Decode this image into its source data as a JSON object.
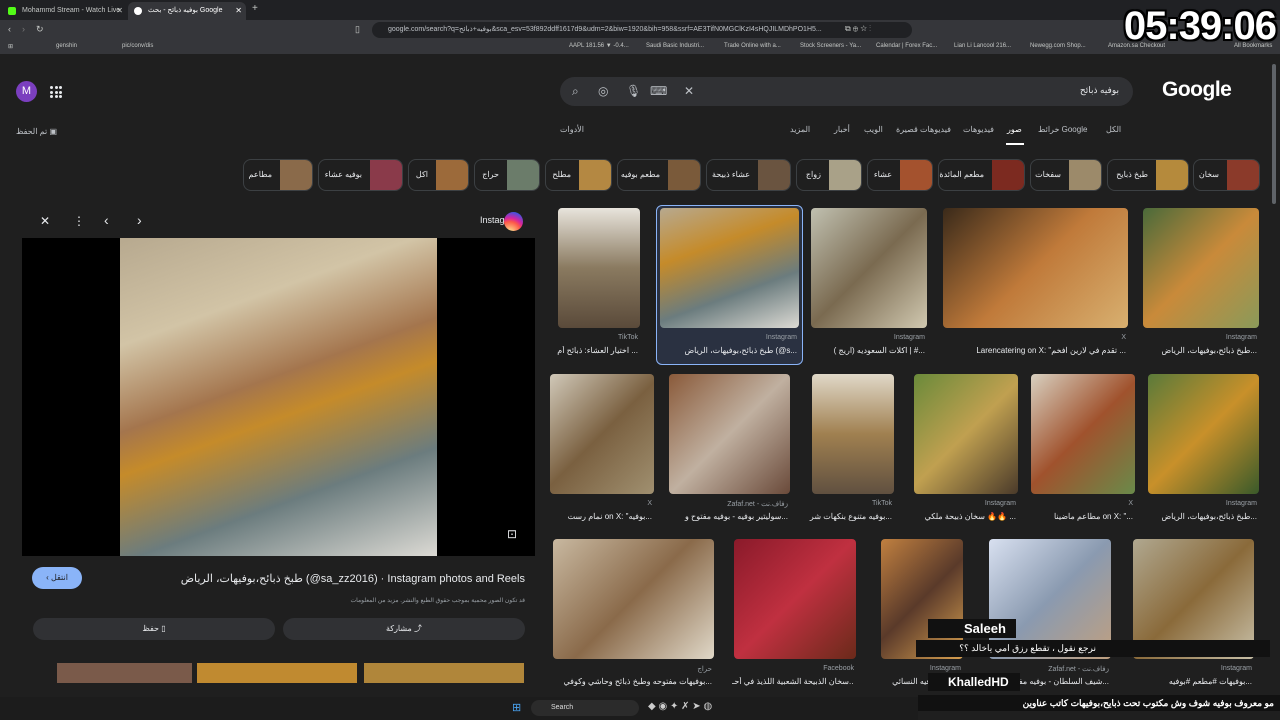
{
  "browser": {
    "tabs": [
      {
        "title": "Mohammd Stream - Watch Live",
        "active": false
      },
      {
        "title": "بوفيه ذبائح - بحث Google",
        "active": true
      }
    ],
    "url": "google.com/search?q=بوفيه+ذبائح&sca_esv=53f892ddff1617d9&udm=2&biw=1920&bih=958&ssrf=AE3TifN0MGClKzI4sHQJILMDhPO1H5...",
    "bookmarks": [
      "genshin",
      "pic/conv/dis",
      "AAPL 181.56 ▼ -0.4...",
      "Saudi Basic Industri...",
      "Trade Online with a...",
      "Stock Screeners - Ya...",
      "Calendar | Forex Fac...",
      "Lian Li Lancool 216...",
      "Newegg.com Shop...",
      "Amazon.sa Checkout",
      "All Bookmarks"
    ]
  },
  "clock": "05:39:06",
  "google": {
    "logo": "Google",
    "avatar_letter": "M",
    "query": "بوفيه ذبائح",
    "nav": [
      "الكل",
      "خرائط Google",
      "صور",
      "فيديوهات",
      "فيديوهات قصيرة",
      "الويب",
      "أخبار",
      "المزيد"
    ],
    "tools": "الأدوات",
    "saved": "تم الحفظ"
  },
  "chips": [
    "سخان",
    "طبخ ذبايح",
    "سفخات",
    "مطعم المائدة",
    "عشاء",
    "زواج",
    "عشاء ذبيحة",
    "مطعم بوفيه",
    "مطلح",
    "حراج",
    "اكل",
    "بوفيه عشاء",
    "مطاعم"
  ],
  "preview": {
    "source": "Instagram",
    "caption": "طبخ ذبائح،بوفيهات، الرياض (@sa_zz2016) · Instagram photos and Reels",
    "notice": "قد تكون الصور محمية بموجب حقوق الطبع والنشر. مزيد من المعلومات",
    "visit": "انتقل",
    "share": "مشاركة",
    "save": "حفظ"
  },
  "results": [
    {
      "source": "Instagram",
      "title": "طبخ ذبائح،بوفيهات، الرياض..."
    },
    {
      "source": "X",
      "title": "Larencatering on X: \"تقدم في لارين افخم ..."
    },
    {
      "source": "Instagram",
      "title": "اكلات السعوديه (اريج ) | #..."
    },
    {
      "source": "Instagram",
      "title": "طبخ ذبائح،بوفيهات، الرياض (@s..."
    },
    {
      "source": "TikTok",
      "title": "اختيار العشاء: ذبائح أم ..."
    },
    {
      "source": "Instagram",
      "title": "طبخ ذبائح،بوفيهات، الرياض..."
    },
    {
      "source": "X",
      "title": "مطاعم ماضينا on X: \"..."
    },
    {
      "source": "Instagram",
      "title": "سخان ذبيحة ملكي 🔥🔥 ..."
    },
    {
      "source": "TikTok",
      "title": "بوفيه متنوع بنكهات شر..."
    },
    {
      "source": "Zafaf.net - زفاف.نت",
      "title": "سوليتير بوفيه - بوفيه مفتوح و..."
    },
    {
      "source": "X",
      "title": "نمام رست on X: \"بوفيه..."
    },
    {
      "source": "Instagram",
      "title": "بوفيهات #مطعم #بوفيه..."
    },
    {
      "source": "Zafaf.net - زفاف.نت",
      "title": "شيف السلطان - بوفيه مفتوح..."
    },
    {
      "source": "Instagram",
      "title": "أو البوفيه النسائي: ..."
    },
    {
      "source": "Facebook",
      "title": "سخان الذبيحة الشعبية اللذيذ في أحـ..."
    },
    {
      "source": "حراج",
      "title": "بوفيهات مفتوحه وطبخ ذبائح وحاشي وكوفي..."
    }
  ],
  "stream_overlay": {
    "user1": "Saleeh",
    "msg1": "نرجع نقول ، تقطع رزق امي ياخالد ؟؟",
    "user2": "KhalledHD",
    "msg2": "مو معروف بوفيه شوف وش مكتوب تحت ذبايح،بوفيهات كاتب عناوين"
  },
  "taskbar": {
    "search": "Search"
  }
}
